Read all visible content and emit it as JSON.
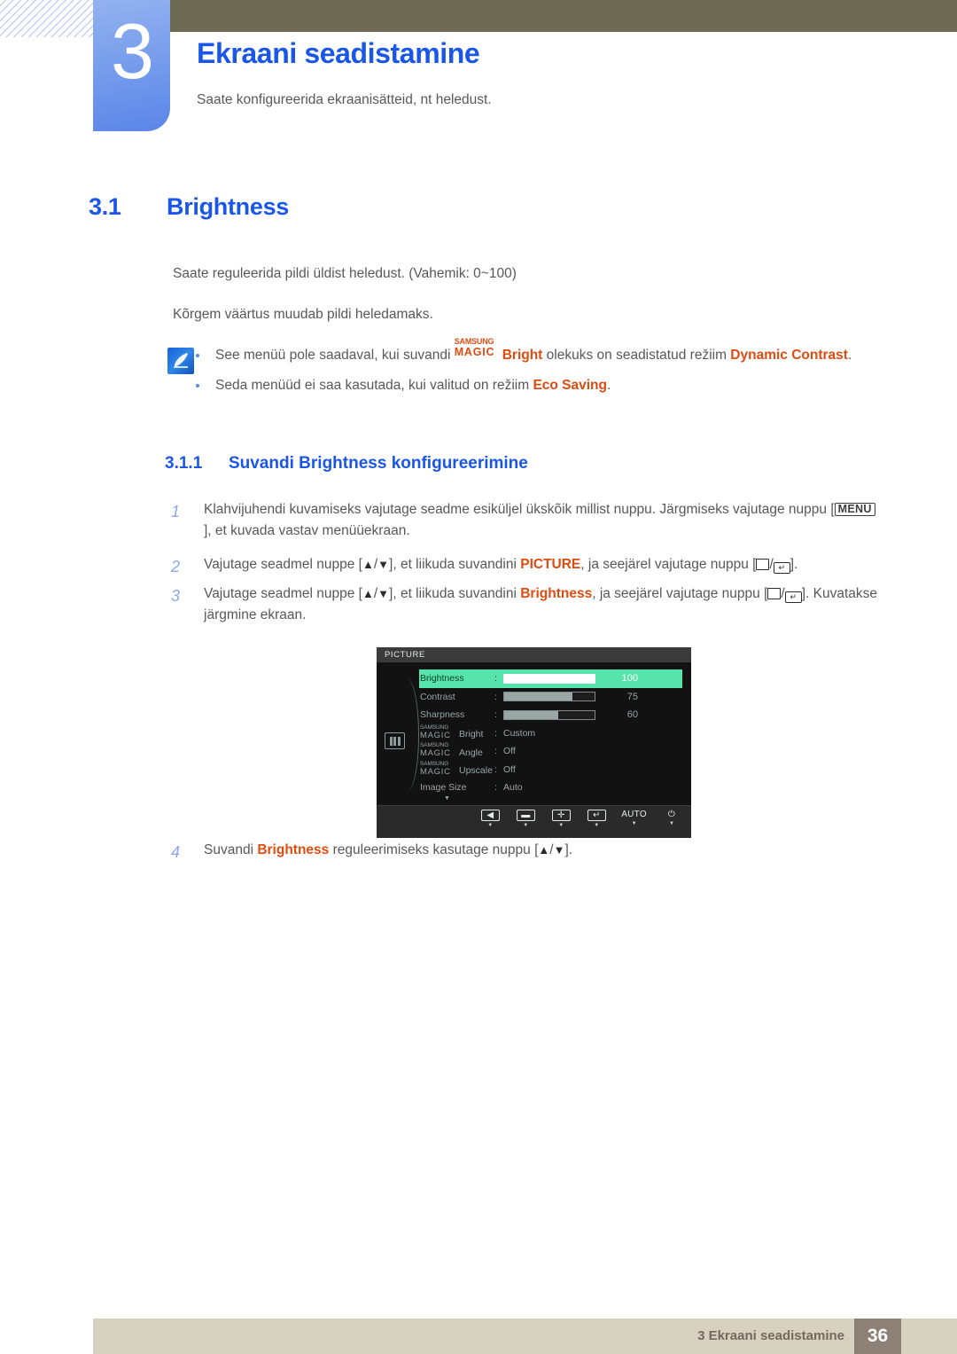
{
  "header": {
    "chapter_number": "3",
    "chapter_title": "Ekraani seadistamine",
    "chapter_subtitle": "Saate konfigureerida ekraanisätteid, nt heledust.",
    "accent_blue": "#1a56e8",
    "tab_blue": "#5b86e8",
    "bar_olive": "#6d6a54"
  },
  "section": {
    "number": "3.1",
    "title": "Brightness",
    "paragraph_1": "Saate reguleerida pildi üldist heledust. (Vahemik: 0~100)",
    "paragraph_2": "Kõrgem väärtus muudab pildi heledamaks."
  },
  "note": {
    "icon": "note-pen-icon",
    "items": [
      {
        "pre": "See menüü pole saadaval, kui suvandi ",
        "magic_top": "SAMSUNG",
        "magic_bottom": "MAGIC",
        "magic_word": "Bright",
        "mid": " olekuks on seadistatud režiim ",
        "accent": "Dynamic Contrast",
        "post": "."
      },
      {
        "pre": "Seda menüüd ei saa kasutada, kui valitud on režiim ",
        "accent": "Eco Saving",
        "post": "."
      }
    ]
  },
  "subsection": {
    "number": "3.1.1",
    "title": "Suvandi Brightness konfigureerimine"
  },
  "steps": [
    {
      "index": "1",
      "part_a": "Klahvijuhendi kuvamiseks vajutage seadme esiküljel ükskõik millist nuppu. Järgmiseks vajutage nuppu [",
      "key": "MENU",
      "part_b": "], et kuvada vastav menüüekraan."
    },
    {
      "index": "2",
      "part_a": "Vajutage seadmel nuppe [",
      "part_b": "], et liikuda suvandini ",
      "accent": "PICTURE",
      "part_c": ", ja seejärel vajutage nuppu [",
      "part_d": "]."
    },
    {
      "index": "3",
      "part_a": "Vajutage seadmel nuppe [",
      "part_b": "], et liikuda suvandini ",
      "accent": "Brightness",
      "part_c": ", ja seejärel vajutage nuppu [",
      "part_d": "]. Kuvatakse järgmine ekraan."
    },
    {
      "index": "4",
      "part_a": "Suvandi ",
      "accent": "Brightness",
      "part_b": " reguleerimiseks kasutage nuppu [",
      "part_c": "]."
    }
  ],
  "osd": {
    "title": "PICTURE",
    "side_icon": "picture-mode-icon",
    "more_indicator": "▼",
    "rows": [
      {
        "label": "Brightness",
        "type": "slider",
        "value": "100",
        "percent": 100,
        "highlighted": true
      },
      {
        "label": "Contrast",
        "type": "slider",
        "value": "75",
        "percent": 75,
        "highlighted": false
      },
      {
        "label": "Sharpness",
        "type": "slider",
        "value": "60",
        "percent": 60,
        "highlighted": false
      },
      {
        "label_top": "SAMSUNG",
        "label_bottom": "MAGIC",
        "label_word": "Bright",
        "type": "magic",
        "value": "Custom"
      },
      {
        "label_top": "SAMSUNG",
        "label_bottom": "MAGIC",
        "label_word": "Angle",
        "type": "magic",
        "value": "Off"
      },
      {
        "label_top": "SAMSUNG",
        "label_bottom": "MAGIC",
        "label_word": "Upscale",
        "type": "magic",
        "value": "Off"
      },
      {
        "label": "Image Size",
        "type": "text",
        "value": "Auto"
      }
    ],
    "buttons": [
      {
        "name": "back-button",
        "glyph": "◀"
      },
      {
        "name": "minus-button",
        "glyph": "▬"
      },
      {
        "name": "plus-button",
        "glyph": "✛"
      },
      {
        "name": "enter-button",
        "glyph": "↵"
      },
      {
        "name": "auto-button",
        "glyph": "AUTO"
      },
      {
        "name": "power-button",
        "glyph": "⏻"
      }
    ],
    "button_submark": "▼",
    "highlight_color": "#57e3ac",
    "background_color": "#121212"
  },
  "footer": {
    "text": "3 Ekraani seadistamine",
    "page": "36",
    "bar_color": "#d7d2bf",
    "page_box_color": "#8d8175"
  }
}
